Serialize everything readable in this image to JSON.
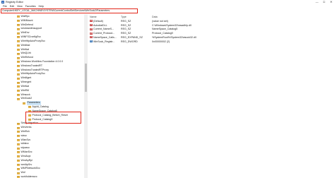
{
  "window": {
    "title": "Registry Editor",
    "controls": [
      "—",
      "☐",
      "✕"
    ]
  },
  "menu": [
    "File",
    "Edit",
    "View",
    "Favorites",
    "Help"
  ],
  "address": "Computer\\HKEY_LOCAL_MACHINE\\SYSTEM\\CurrentControlSet\\Services\\WinSock2\\Parameters",
  "tree": {
    "items": [
      {
        "label": "WiaRpc"
      },
      {
        "label": "WIMMount"
      },
      {
        "label": "WinDefend"
      },
      {
        "label": "windowsitmsupport"
      },
      {
        "label": "WinEnv"
      },
      {
        "label": "WINFSCronfigSvc"
      },
      {
        "label": "WinHttpAutoProxySvc"
      },
      {
        "label": "WinMad"
      },
      {
        "label": "WinNat"
      },
      {
        "label": "WinQUrh"
      },
      {
        "label": "WinRefund"
      },
      {
        "label": "Windows Workflow Foundation 4.0.0.0"
      },
      {
        "label": "WindowsTrustedRT"
      },
      {
        "label": "WindowsTrustedRTProxy"
      },
      {
        "label": "WinHttpAutoProxySvc"
      },
      {
        "label": "WinMgmt"
      },
      {
        "label": "Winmgmt"
      },
      {
        "label": "WinNat"
      },
      {
        "label": "WinRM"
      },
      {
        "label": "Winsock"
      },
      {
        "label": "WinSock2"
      },
      {
        "label": "Parameters",
        "selected": true
      },
      {
        "label": "AppId_Catalog"
      },
      {
        "label": "NameSpace_Catalog5"
      },
      {
        "label": "Protocol_Catalog_Before_Reset"
      },
      {
        "label": "Protocol_Catalog9"
      },
      {
        "label": "Setup Migration"
      },
      {
        "label": "WinVerbs"
      },
      {
        "label": "WinRsh"
      },
      {
        "label": "wisvc"
      },
      {
        "label": "WlanSvc"
      },
      {
        "label": "wlidsvc"
      },
      {
        "label": "wlpasvc"
      },
      {
        "label": "WManSvc"
      },
      {
        "label": "WmiAcpi"
      },
      {
        "label": "WmiApRpl"
      },
      {
        "label": "wmiApSrv"
      },
      {
        "label": "WMPNetworkSvc"
      },
      {
        "label": "Wof"
      },
      {
        "label": "workfolderssvc"
      }
    ]
  },
  "values": {
    "headers": {
      "name": "Name",
      "type": "Type",
      "data": "Data"
    },
    "rows": [
      {
        "name": "(Default)",
        "type": "REG_SZ",
        "data": "(value not set)",
        "icon": "ab"
      },
      {
        "name": "AutodialDLL",
        "type": "REG_SZ",
        "data": "C:\\Windows\\System32\\rasadhlp.dll",
        "icon": "ab"
      },
      {
        "name": "Current_NameS...",
        "type": "REG_SZ",
        "data": "NameSpace_Catalog5",
        "icon": "ab"
      },
      {
        "name": "Current_Protocol...",
        "type": "REG_SZ",
        "data": "Protocol_Catalog9",
        "icon": "ab"
      },
      {
        "name": "NameSpace_Calls...",
        "type": "REG_EXPAND_SZ",
        "data": "%SystemRoot%\\System32\\wsock32.dll",
        "icon": "ab"
      },
      {
        "name": "WinSock_Registr...",
        "type": "REG_DWORD",
        "data": "0x00000002 (2)",
        "icon": "01"
      }
    ]
  },
  "colors": {
    "highlight_border": "#e2271a",
    "selection": "#cce4f7",
    "folder": "#e8b64c"
  }
}
